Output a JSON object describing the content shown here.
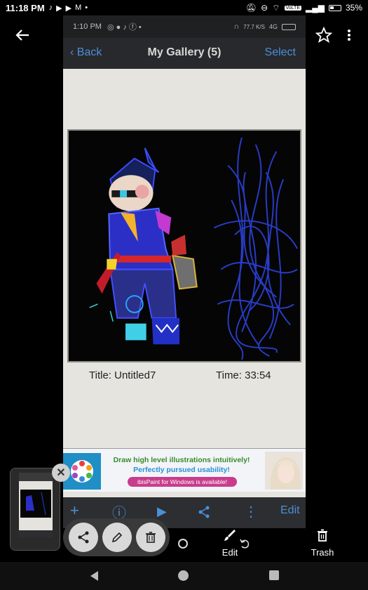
{
  "status_bar": {
    "time": "11:18 PM",
    "icons": [
      "tiktok-icon",
      "youtube-icon",
      "youtube-icon",
      "gmail-icon",
      "dot-icon"
    ],
    "right_icons": [
      "mute-icon",
      "dnd-icon",
      "wifi-icon",
      "volte-icon",
      "signal-icon",
      "battery-icon"
    ],
    "volte": "VoLTE",
    "battery": "35%",
    "battery_level": 0.35
  },
  "viewer": {
    "actions": {
      "edit_label": "Edit",
      "trash_label": "Trash"
    }
  },
  "screenshot": {
    "status": {
      "time": "1:10 PM",
      "signal_text": "77.7 K/S",
      "net": "4G"
    },
    "nav": {
      "back_label": "Back",
      "title": "My Gallery (5)",
      "select_label": "Select"
    },
    "artwork": {
      "title_text": "Title: Untitled7",
      "time_text": "Time:   33:54"
    },
    "ad": {
      "line1": "Draw high level illustrations intuitively!",
      "line2": "Perfectly pursued usability!",
      "pill": "ibisPaint for Windows is available!"
    },
    "toolbar": {
      "add": "+",
      "info": "ⓘ",
      "play": "▶",
      "share": "share-icon",
      "more": "⋮",
      "edit_label": "Edit"
    }
  },
  "colors": {
    "accent_blue": "#4a90d9",
    "toolbar_bg": "#2d2e31",
    "page_bg": "#e5e4df"
  }
}
